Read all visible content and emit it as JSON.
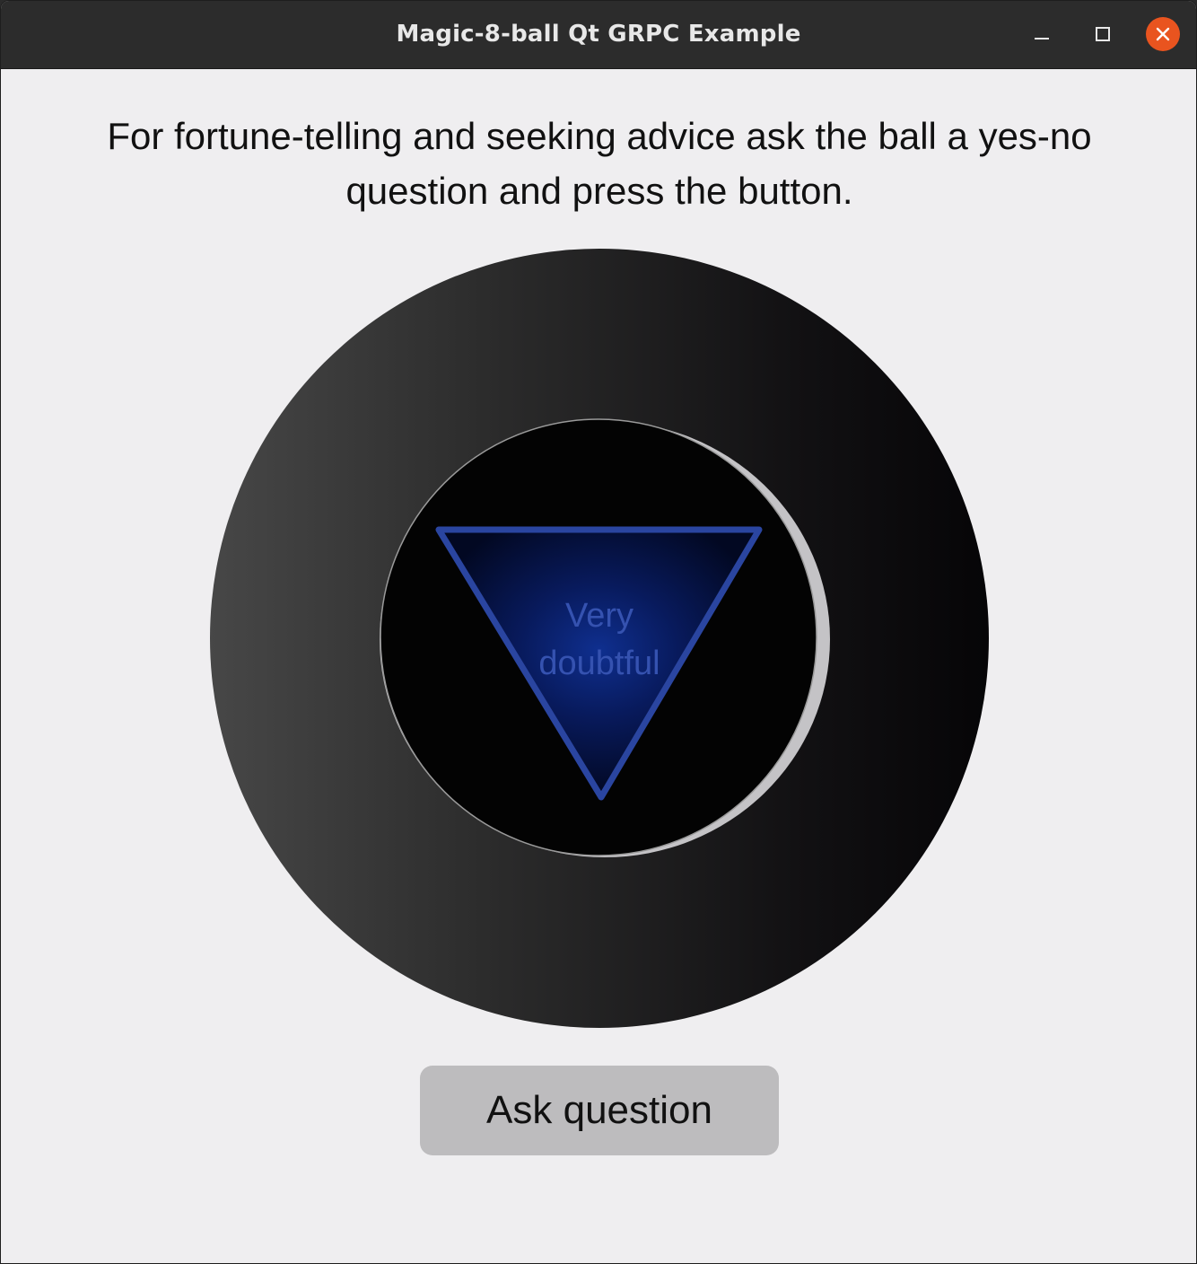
{
  "window": {
    "title": "Magic-8-ball Qt GRPC Example",
    "controls": {
      "minimize_icon": "minimize-icon",
      "maximize_icon": "maximize-icon",
      "close_icon": "close-icon",
      "close_color": "#e9541f"
    }
  },
  "main": {
    "prompt": "For fortune-telling and seeking advice ask the ball a yes-no question and press the button.",
    "answer_line1": "Very",
    "answer_line2": "doubtful",
    "ask_button_label": "Ask question"
  },
  "colors": {
    "background": "#efeef0",
    "triangle_stroke": "#2a45a0",
    "answer_text": "#3552b0",
    "button_bg": "#bdbcbe"
  }
}
